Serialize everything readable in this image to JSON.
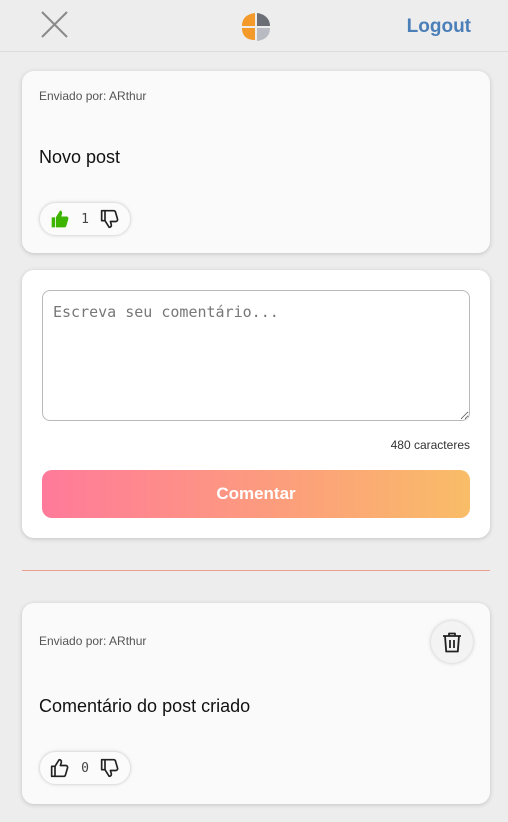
{
  "header": {
    "logout_label": "Logout"
  },
  "post": {
    "sent_by": "Enviado por: ARthur",
    "text": "Novo post",
    "likes": "1",
    "liked": true,
    "like_color": "#3cb400"
  },
  "comment_form": {
    "placeholder": "Escreva seu comentário...",
    "char_count": "480 caracteres",
    "submit_label": "Comentar"
  },
  "comment": {
    "sent_by": "Enviado por: ARthur",
    "text": "Comentário do post criado",
    "likes": "0"
  },
  "colors": {
    "accent_blue": "#4a7fb8",
    "logo_orange": "#f39a2b",
    "logo_gray": "#6b6f75",
    "gradient_start": "#ff7a9a",
    "gradient_end": "#f9bd67",
    "divider": "#e9a08e"
  },
  "icons": [
    "close-icon",
    "app-logo",
    "thumbs-up-icon",
    "thumbs-down-icon",
    "trash-icon"
  ]
}
